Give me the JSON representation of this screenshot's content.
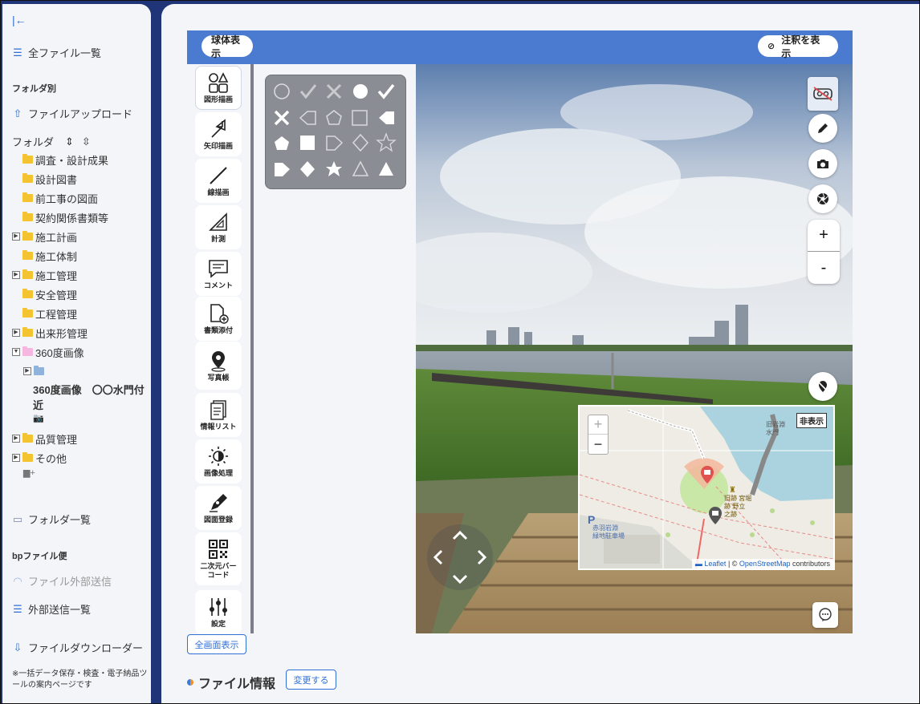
{
  "sidebar": {
    "collapse_icon": "collapse-left-icon",
    "all_files": "全ファイル一覧",
    "by_folder_heading": "フォルダ別",
    "upload": "ファイルアップロード",
    "folder_label": "フォルダ",
    "tree": [
      {
        "label": "調査・設計成果",
        "expandable": false
      },
      {
        "label": "設計図書",
        "expandable": false
      },
      {
        "label": "前工事の図面",
        "expandable": false
      },
      {
        "label": "契約関係書類等",
        "expandable": false
      },
      {
        "label": "施工計画",
        "expandable": true
      },
      {
        "label": "施工体制",
        "expandable": false
      },
      {
        "label": "施工管理",
        "expandable": true
      },
      {
        "label": "安全管理",
        "expandable": false
      },
      {
        "label": "工程管理",
        "expandable": false
      },
      {
        "label": "出来形管理",
        "expandable": true
      },
      {
        "label": "360度画像",
        "expandable": true,
        "expanded": true
      }
    ],
    "selected_item": "360度画像　〇〇水門付近",
    "tree_after": [
      {
        "label": "品質管理",
        "expandable": true
      },
      {
        "label": "その他",
        "expandable": true
      }
    ],
    "folder_list": "フォルダ一覧",
    "bp_heading": "bpファイル便",
    "external_send": "ファイル外部送信",
    "external_send_list": "外部送信一覧",
    "downloader": "ファイルダウンローダー",
    "note": "※一括データ保存・検査・電子納品ツールの案内ページです"
  },
  "viewer": {
    "sphere_button": "球体表示",
    "annotation_button": "注釈を表示",
    "tools": [
      {
        "label": "図形描画",
        "icon": "shapes-icon",
        "selected": true
      },
      {
        "label": "矢印描画",
        "icon": "arrow-draw-icon"
      },
      {
        "label": "線描画",
        "icon": "line-draw-icon"
      },
      {
        "label": "計測",
        "icon": "ruler-icon"
      },
      {
        "label": "コメント",
        "icon": "comment-icon"
      },
      {
        "label": "書類添付",
        "icon": "attach-document-icon"
      },
      {
        "label": "写真帳",
        "icon": "location-pin-icon"
      },
      {
        "label": "情報リスト",
        "icon": "info-list-icon"
      },
      {
        "label": "画像処理",
        "icon": "brightness-icon"
      },
      {
        "label": "図面登録",
        "icon": "pen-nib-icon"
      },
      {
        "label": "二次元バーコード",
        "icon": "qr-code-icon"
      },
      {
        "label": "設定",
        "icon": "settings-sliders-icon"
      }
    ],
    "map": {
      "hide_button": "非表示",
      "zoom_in": "+",
      "zoom_out": "−",
      "label_p": "P",
      "label_parking": "赤羽岩淵\n緑地駐車場",
      "label_site": "旧岩淵水門",
      "label_monument": "旧跡 宮堀\n跡 野立\n之跡",
      "attribution_leaflet": "Leaflet",
      "attribution_sep": " | © ",
      "attribution_osm": "OpenStreetMap",
      "attribution_suffix": " contributors"
    },
    "zoom_plus": "+",
    "zoom_minus": "-"
  },
  "fullscreen_button": "全画面表示",
  "file_info": {
    "title": "ファイル情報",
    "change_button": "変更する"
  }
}
